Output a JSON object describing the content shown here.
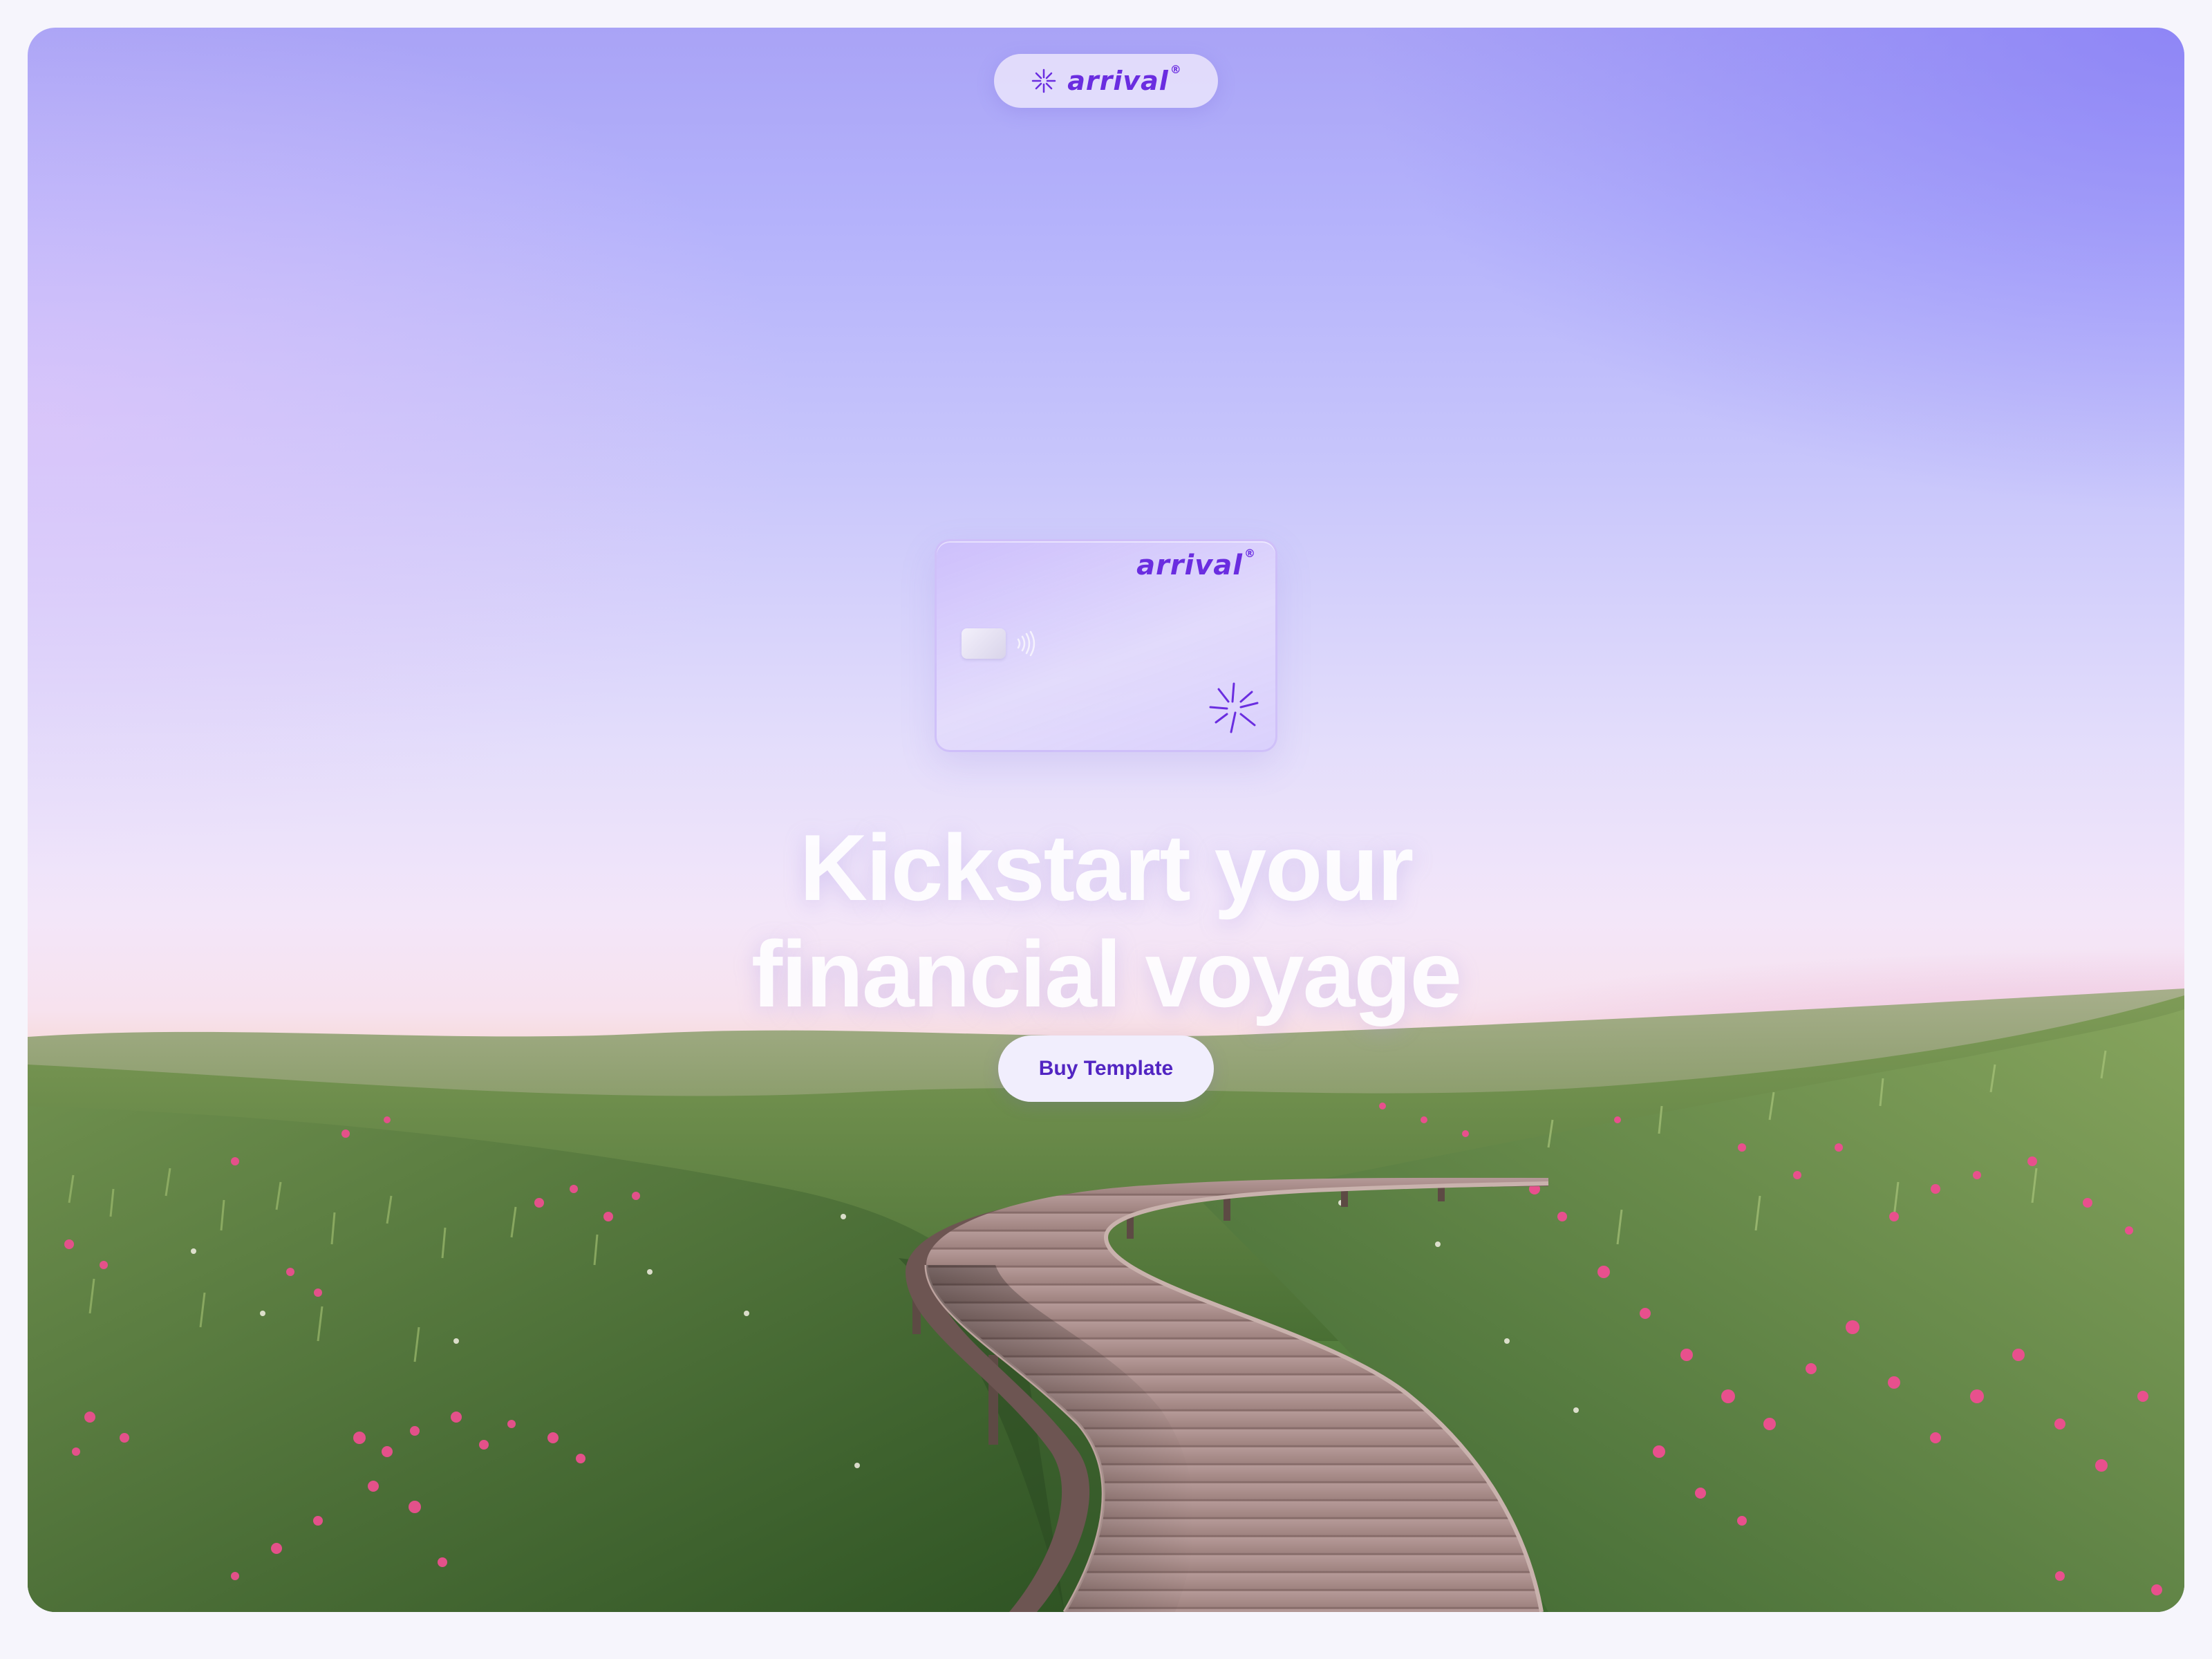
{
  "brand": {
    "name": "arrival",
    "mark": "®"
  },
  "card": {
    "brand": "arrival",
    "mark": "®"
  },
  "hero": {
    "headline_line1": "Kickstart your",
    "headline_line2": "financial voyage",
    "cta_label": "Buy Template"
  },
  "colors": {
    "brand_purple": "#6a2de0",
    "cta_text": "#5225c2",
    "cta_background": "#f1eefd"
  },
  "icons": {
    "logo_mark": "sparkle-icon",
    "card_chip": "chip-icon",
    "card_contactless": "contactless-icon",
    "card_mark": "sparkle-icon"
  }
}
